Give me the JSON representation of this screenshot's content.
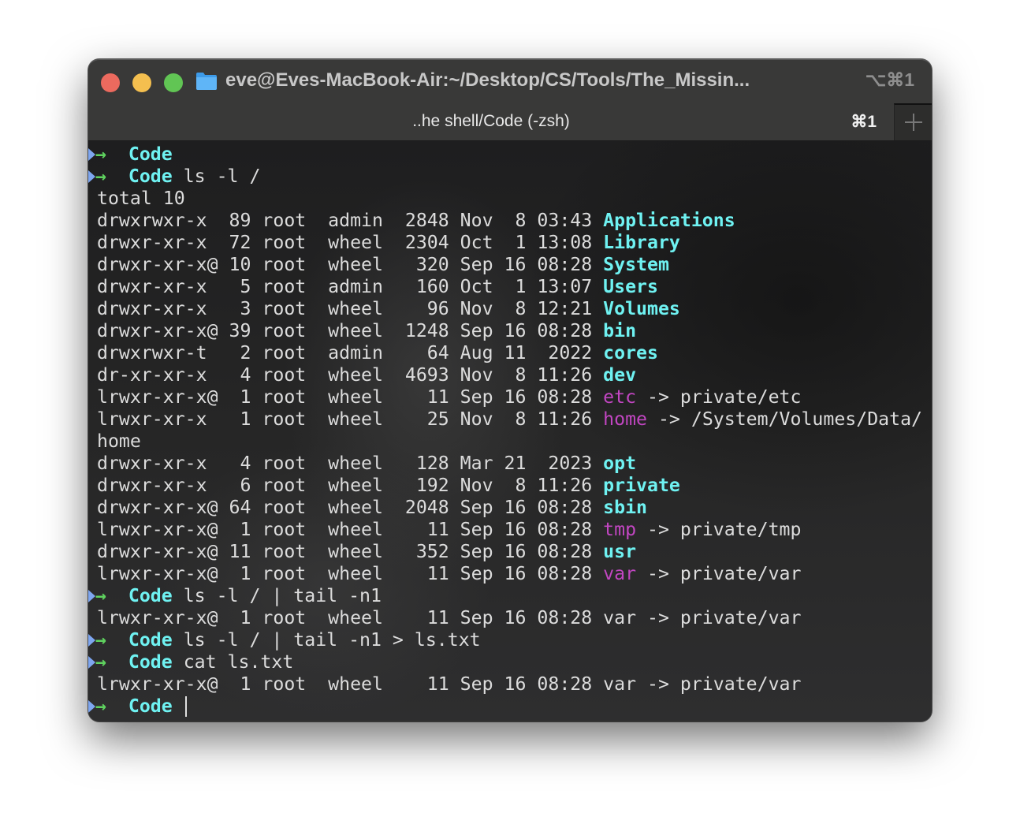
{
  "window": {
    "title": "eve@Eves-MacBook-Air:~/Desktop/CS/Tools/The_Missin...",
    "shortcut": "⌥⌘1",
    "icon": "folder-icon",
    "traffic_lights": [
      "close",
      "minimize",
      "maximize"
    ]
  },
  "tabs": [
    {
      "label": "..he shell/Code (-zsh)",
      "shortcut": "⌘1",
      "active": true
    }
  ],
  "new_tab_icon": "plus-icon",
  "colors": {
    "prompt_triangle": "#7ea6f0",
    "prompt_arrow": "#5fd35f",
    "directory": "#6ff2f2",
    "symlink": "#c246c2",
    "text": "#dcdcdc"
  },
  "prompt": {
    "arrow": "→",
    "dir": "Code"
  },
  "terminal": {
    "lines": [
      {
        "type": "prompt",
        "command": ""
      },
      {
        "type": "prompt",
        "command": " ls -l /"
      },
      {
        "type": "text",
        "text": "total 10"
      },
      {
        "type": "entry",
        "prefix": "drwxrwxr-x  89 root  admin  2848 Nov  8 03:43 ",
        "name": "Applications",
        "kind": "dir",
        "suffix": ""
      },
      {
        "type": "entry",
        "prefix": "drwxr-xr-x  72 root  wheel  2304 Oct  1 13:08 ",
        "name": "Library",
        "kind": "dir",
        "suffix": ""
      },
      {
        "type": "entry",
        "prefix": "drwxr-xr-x@ 10 root  wheel   320 Sep 16 08:28 ",
        "name": "System",
        "kind": "dir",
        "suffix": ""
      },
      {
        "type": "entry",
        "prefix": "drwxr-xr-x   5 root  admin   160 Oct  1 13:07 ",
        "name": "Users",
        "kind": "dir",
        "suffix": ""
      },
      {
        "type": "entry",
        "prefix": "drwxr-xr-x   3 root  wheel    96 Nov  8 12:21 ",
        "name": "Volumes",
        "kind": "dir",
        "suffix": ""
      },
      {
        "type": "entry",
        "prefix": "drwxr-xr-x@ 39 root  wheel  1248 Sep 16 08:28 ",
        "name": "bin",
        "kind": "dir",
        "suffix": ""
      },
      {
        "type": "entry",
        "prefix": "drwxrwxr-t   2 root  admin    64 Aug 11  2022 ",
        "name": "cores",
        "kind": "dir",
        "suffix": ""
      },
      {
        "type": "entry",
        "prefix": "dr-xr-xr-x   4 root  wheel  4693 Nov  8 11:26 ",
        "name": "dev",
        "kind": "dir",
        "suffix": ""
      },
      {
        "type": "entry",
        "prefix": "lrwxr-xr-x@  1 root  wheel    11 Sep 16 08:28 ",
        "name": "etc",
        "kind": "link",
        "suffix": " -> private/etc"
      },
      {
        "type": "entry",
        "prefix": "lrwxr-xr-x   1 root  wheel    25 Nov  8 11:26 ",
        "name": "home",
        "kind": "link",
        "suffix": " -> /System/Volumes/Data/"
      },
      {
        "type": "text",
        "text": "home"
      },
      {
        "type": "entry",
        "prefix": "drwxr-xr-x   4 root  wheel   128 Mar 21  2023 ",
        "name": "opt",
        "kind": "dir",
        "suffix": ""
      },
      {
        "type": "entry",
        "prefix": "drwxr-xr-x   6 root  wheel   192 Nov  8 11:26 ",
        "name": "private",
        "kind": "dir",
        "suffix": ""
      },
      {
        "type": "entry",
        "prefix": "drwxr-xr-x@ 64 root  wheel  2048 Sep 16 08:28 ",
        "name": "sbin",
        "kind": "dir",
        "suffix": ""
      },
      {
        "type": "entry",
        "prefix": "lrwxr-xr-x@  1 root  wheel    11 Sep 16 08:28 ",
        "name": "tmp",
        "kind": "link",
        "suffix": " -> private/tmp"
      },
      {
        "type": "entry",
        "prefix": "drwxr-xr-x@ 11 root  wheel   352 Sep 16 08:28 ",
        "name": "usr",
        "kind": "dir",
        "suffix": ""
      },
      {
        "type": "entry",
        "prefix": "lrwxr-xr-x@  1 root  wheel    11 Sep 16 08:28 ",
        "name": "var",
        "kind": "link",
        "suffix": " -> private/var"
      },
      {
        "type": "prompt",
        "command": " ls -l / | tail -n1"
      },
      {
        "type": "text",
        "text": "lrwxr-xr-x@  1 root  wheel    11 Sep 16 08:28 var -> private/var"
      },
      {
        "type": "prompt",
        "command": " ls -l / | tail -n1 > ls.txt"
      },
      {
        "type": "prompt",
        "command": " cat ls.txt"
      },
      {
        "type": "text",
        "text": "lrwxr-xr-x@  1 root  wheel    11 Sep 16 08:28 var -> private/var"
      },
      {
        "type": "prompt",
        "command": " ",
        "cursor": true
      }
    ]
  }
}
